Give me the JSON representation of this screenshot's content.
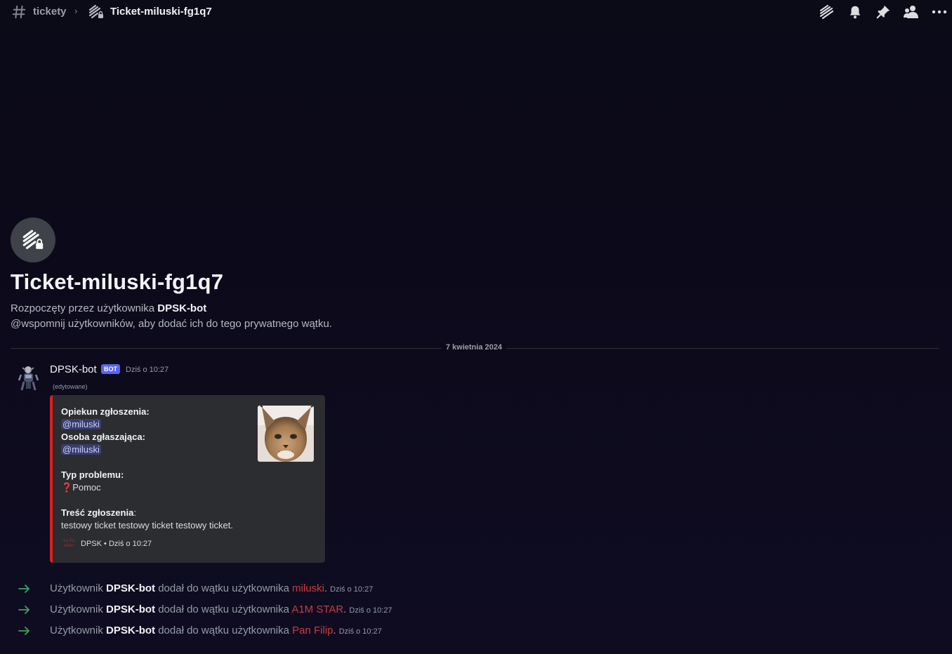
{
  "header": {
    "channel": "tickety",
    "thread": "Ticket-miluski-fg1q7",
    "actions": [
      {
        "name": "threads-icon"
      },
      {
        "name": "bell-icon"
      },
      {
        "name": "pin-icon"
      },
      {
        "name": "members-icon"
      },
      {
        "name": "more-icon"
      }
    ]
  },
  "intro": {
    "title": "Ticket-miluski-fg1q7",
    "started_prefix": "Rozpoczęty przez użytkownika",
    "started_user": "DPSK-bot",
    "hint": "@wspomnij użytkowników, aby dodać ich do tego prywatnego wątku."
  },
  "divider": {
    "date": "7 kwietnia 2024"
  },
  "message": {
    "author": "DPSK-bot",
    "bot_tag": "BOT",
    "time": "Dziś o 10:27",
    "edited": "(edytowane)",
    "embed": {
      "accent_color": "#e01e1e",
      "fields": {
        "opiekun_label": "Opiekun zgłoszenia:",
        "opiekun_value": "@miluski",
        "osoba_label": "Osoba zgłaszająca:",
        "osoba_value": "@miluski",
        "typ_label": "Typ problemu:",
        "typ_emoji": "❓",
        "typ_value": "Pomoc",
        "tresc_label": "Treść zgłoszenia",
        "tresc_colon": ":",
        "tresc_value": "testowy ticket testowy ticket testowy ticket."
      },
      "footer_icon_text": "ica Pic tation",
      "footer_name": "DPSK",
      "footer_sep": "•",
      "footer_time": "Dziś o 10:27"
    }
  },
  "system_messages": [
    {
      "prefix": "Użytkownik",
      "actor": "DPSK-bot",
      "middle": "dodał do wątku użytkownika",
      "target": "miluski",
      "suffix": ".",
      "time": "Dziś o 10:27"
    },
    {
      "prefix": "Użytkownik",
      "actor": "DPSK-bot",
      "middle": "dodał do wątku użytkownika",
      "target": "A1M STAR",
      "suffix": ".",
      "time": "Dziś o 10:27"
    },
    {
      "prefix": "Użytkownik",
      "actor": "DPSK-bot",
      "middle": "dodał do wątku użytkownika",
      "target": "Pan Filip",
      "suffix": ".",
      "time": "Dziś o 10:27"
    }
  ],
  "colors": {
    "background": "#0c0a1a",
    "bot_tag": "#5865f2",
    "mention_text": "#c9cdfb",
    "role_red": "#c93c3c",
    "arrow_green": "#3ba55d"
  }
}
